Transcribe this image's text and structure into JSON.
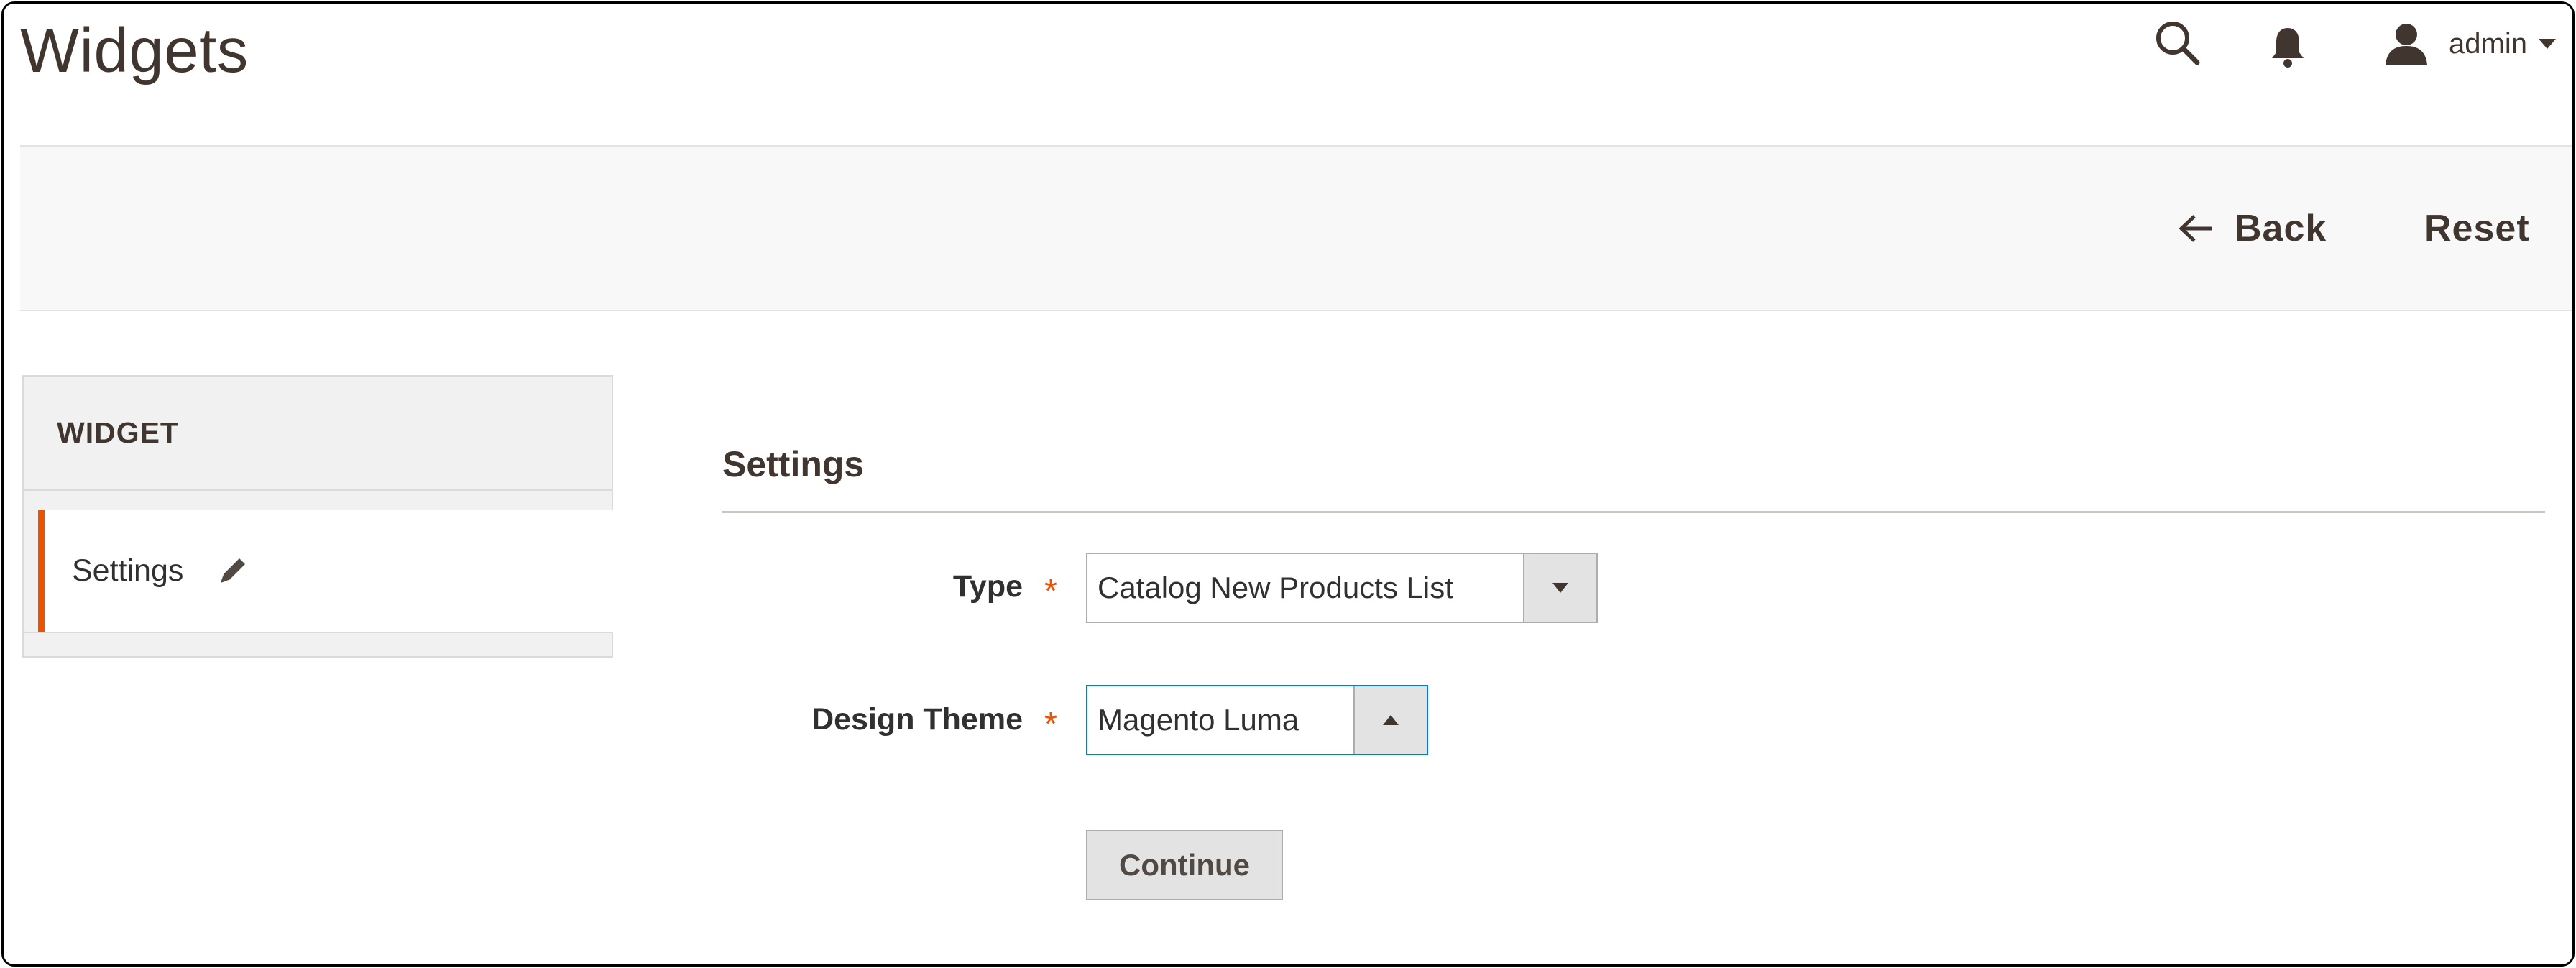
{
  "header": {
    "title": "Widgets",
    "user_name": "admin",
    "icons": [
      "search-icon",
      "bell-icon",
      "user-icon",
      "caret-down-icon"
    ]
  },
  "action_bar": {
    "back_label": "Back",
    "reset_label": "Reset"
  },
  "sidebar": {
    "title": "WIDGET",
    "items": [
      {
        "label": "Settings",
        "active": true,
        "icon": "pencil-icon"
      }
    ]
  },
  "form": {
    "section_title": "Settings",
    "type": {
      "label": "Type",
      "required_mark": "*",
      "value": "Catalog New Products List"
    },
    "design_theme": {
      "label": "Design Theme",
      "required_mark": "*",
      "value": "Magento Luma"
    },
    "continue_label": "Continue"
  },
  "colors": {
    "accent": "#eb5202",
    "focus_border": "#007bdb",
    "text_dark": "#41362f",
    "action_bar_bg": "#f8f8f8"
  }
}
